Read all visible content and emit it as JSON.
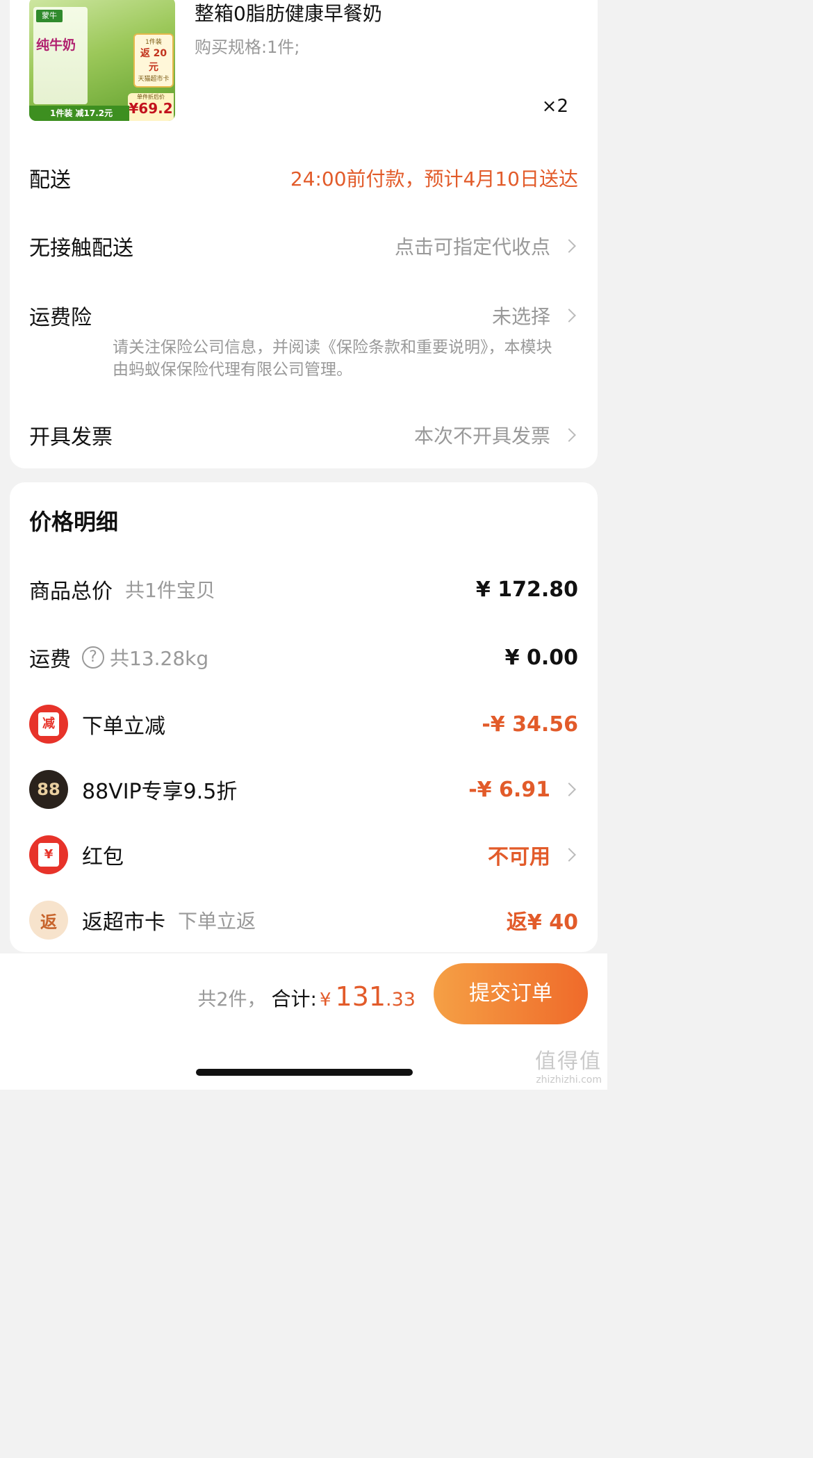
{
  "product": {
    "thumb": {
      "brand": "蒙牛",
      "name": "纯牛奶",
      "badge_top": "1件装",
      "badge_main": "返 20 元",
      "badge_bottom": "天猫超市卡",
      "price_label": "单件折后价",
      "price_value": "¥69.2",
      "strip": "1件装  减17.2元"
    },
    "title": "整箱0脂肪健康早餐奶",
    "spec": "购买规格:1件;",
    "qty": "×2"
  },
  "options": [
    {
      "label": "配送",
      "value": "24:00前付款，预计4月10日送达",
      "highlight": true,
      "chevron": false
    },
    {
      "label": "无接触配送",
      "value": "点击可指定代收点",
      "highlight": false,
      "chevron": true
    },
    {
      "label": "运费险",
      "value": "未选择",
      "highlight": false,
      "chevron": true
    },
    {
      "label": "开具发票",
      "value": "本次不开具发票",
      "highlight": false,
      "chevron": true
    }
  ],
  "insurance_notice": "请关注保险公司信息，并阅读《保险条款和重要说明》，本模块由蚂蚁保保险代理有限公司管理。",
  "price_detail": {
    "title": "价格明细",
    "rows": [
      {
        "name": "商品总价",
        "sub": "共1件宝贝",
        "amount": "¥ 172.80"
      },
      {
        "name": "运费",
        "sub": "共13.28kg",
        "amount": "¥ 0.00"
      },
      {
        "name": "下单立减",
        "icon": "减",
        "amount": "-¥ 34.56"
      },
      {
        "name": "88VIP专享9.5折",
        "icon": "88",
        "amount": "-¥ 6.91"
      },
      {
        "name": "红包",
        "icon": "¥",
        "amount": "不可用"
      },
      {
        "name": "返超市卡",
        "icon": "返",
        "sub": "下单立返",
        "amount": "返¥ 40"
      }
    ]
  },
  "footer": {
    "count": "共2件，",
    "sum_label": "合计:",
    "yen": "¥",
    "total_int": "131",
    "total_dec": ".33",
    "submit": "提交订单"
  },
  "watermark": {
    "text": "值得值",
    "url": "zhizhizhi.com"
  },
  "colors": {
    "accent": "#e25b2a",
    "button_start": "#f5a045",
    "button_end": "#ef6a2a"
  }
}
